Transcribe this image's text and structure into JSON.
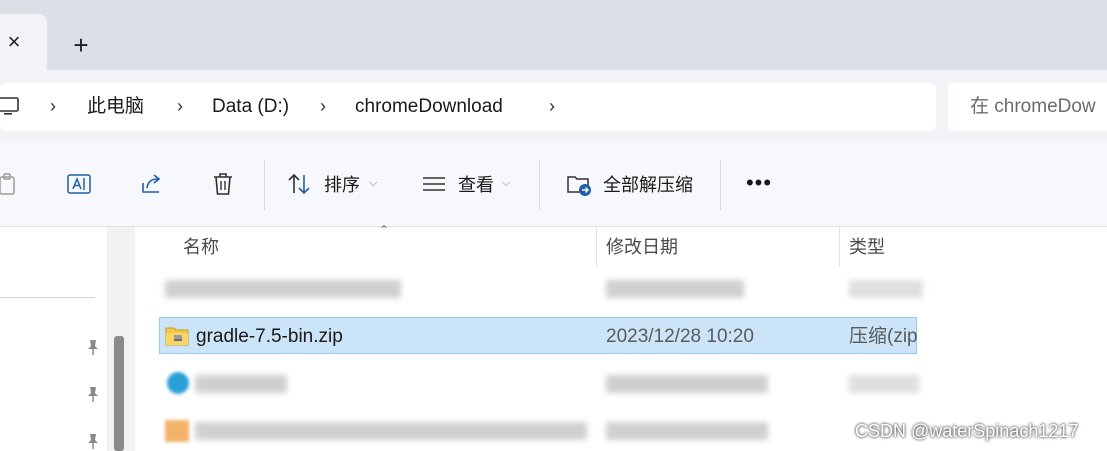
{
  "tabs": {
    "close_glyph": "×",
    "new_tab_glyph": "+"
  },
  "breadcrumb": {
    "separator": "›",
    "items": [
      "此电脑",
      "Data (D:)",
      "chromeDownload"
    ]
  },
  "search": {
    "placeholder": "在 chromeDow"
  },
  "commandbar": {
    "sort_label": "排序",
    "view_label": "查看",
    "extract_label": "全部解压缩",
    "more_label": "•••",
    "caret": "⌵",
    "icons": [
      "paste-icon",
      "rename-icon",
      "share-icon",
      "delete-icon",
      "sort-icon",
      "view-icon",
      "extract-all-icon"
    ]
  },
  "file_list": {
    "columns": {
      "name": "名称",
      "date": "修改日期",
      "type": "类型"
    },
    "sort_indicator": "⌃",
    "selected_file": {
      "name": "gradle-7.5-bin.zip",
      "modified": "2023/12/28 10:20",
      "type": "压缩(zip"
    }
  },
  "watermark": "CSDN @waterSpinach1217",
  "colors": {
    "selection_bg": "#cce4f7",
    "selection_border": "#99c9ef",
    "tabstrip_bg": "#dcdfe8",
    "address_row_bg": "#f2f3f7"
  }
}
